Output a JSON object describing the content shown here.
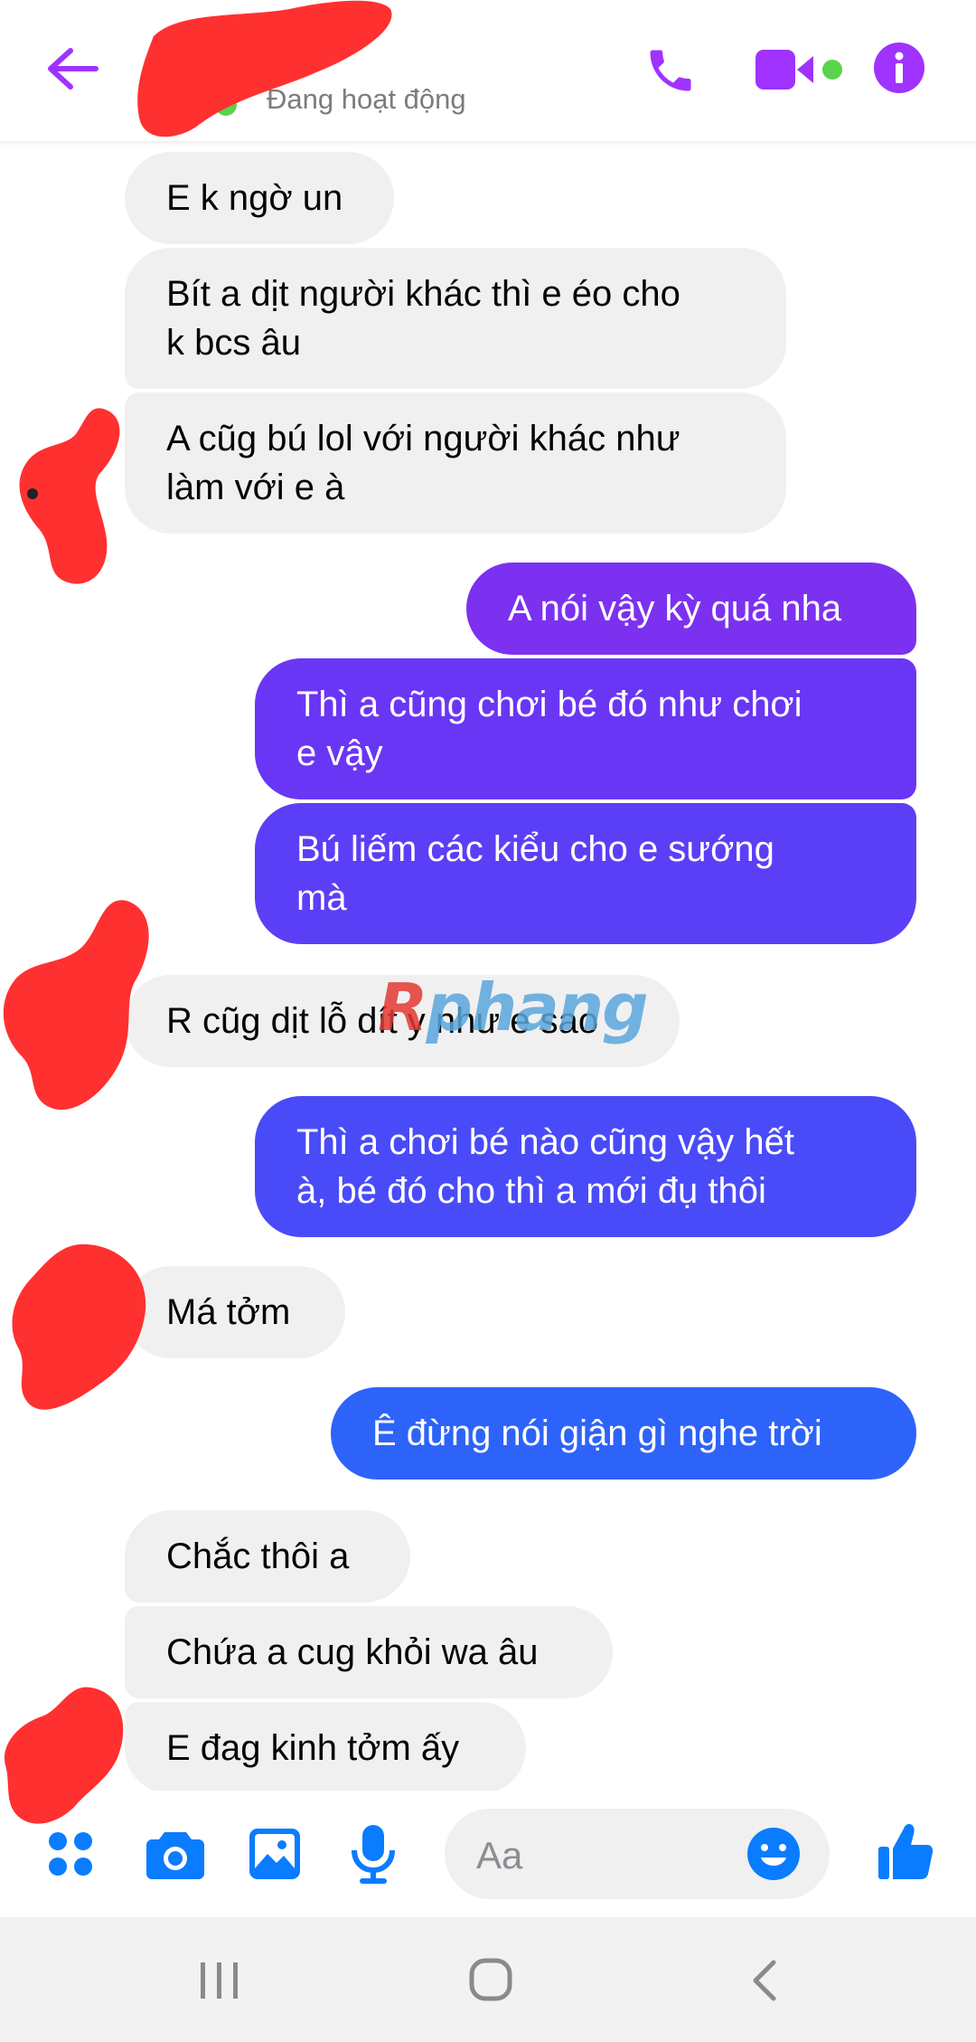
{
  "header": {
    "status": "Đang hoạt động",
    "icons": [
      "back-arrow-icon",
      "phone-icon",
      "video-icon",
      "info-icon"
    ],
    "accent_color": "#a033ff",
    "active_color": "#5bd34a"
  },
  "messages": [
    {
      "dir": "in",
      "text": "E k ngờ un"
    },
    {
      "dir": "in",
      "text": "Bít a dịt người khác thì e éo cho\nk bcs âu"
    },
    {
      "dir": "in",
      "text": "A cũg bú lol với người khác như\nlàm với e à"
    },
    {
      "dir": "out",
      "text": "A nói vậy kỳ quá nha"
    },
    {
      "dir": "out",
      "text": "Thì a cũng chơi bé đó như chơi\ne vậy"
    },
    {
      "dir": "out",
      "text": "Bú liếm các kiểu cho e sướng\nmà"
    },
    {
      "dir": "in",
      "text": "R cũg dịt lỗ dít y như e sao"
    },
    {
      "dir": "out",
      "text": "Thì a chơi bé nào cũng vậy hết\nà, bé đó cho thì a mới đụ thôi"
    },
    {
      "dir": "in",
      "text": "Má tởm"
    },
    {
      "dir": "out",
      "text": "Ê đừng nói giận gì nghe trời"
    },
    {
      "dir": "in",
      "text": "Chắc thôi a"
    },
    {
      "dir": "in",
      "text": "Chứa a cug khỏi wa âu"
    },
    {
      "dir": "in",
      "text": "E đag kinh tởm ấy"
    }
  ],
  "watermark": {
    "first": "R",
    "rest": "phang"
  },
  "composer": {
    "placeholder": "Aa",
    "icons": [
      "apps-icon",
      "camera-icon",
      "gallery-icon",
      "mic-icon",
      "emoji-icon",
      "like-icon"
    ],
    "icon_color": "#0a7cff"
  },
  "navbar": {
    "icons": [
      "recents-icon",
      "home-icon",
      "back-icon"
    ]
  },
  "colors": {
    "incoming_bubble": "#f0f0f0",
    "redaction": "#ff3030",
    "gradient_top": "#8a2be2",
    "gradient_bottom": "#1f6bff"
  }
}
